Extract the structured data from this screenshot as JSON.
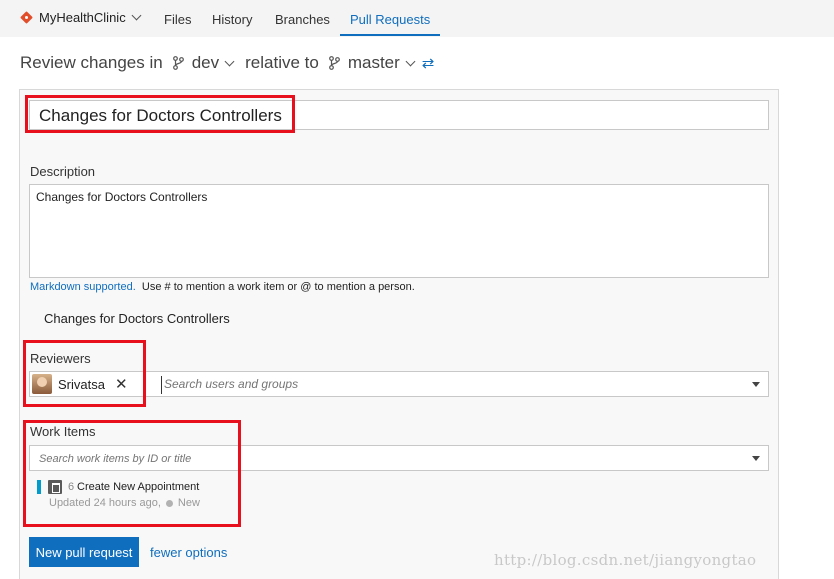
{
  "nav": {
    "repo_name": "MyHealthClinic",
    "tabs": [
      {
        "label": "Files"
      },
      {
        "label": "History"
      },
      {
        "label": "Branches"
      },
      {
        "label": "Pull Requests"
      }
    ],
    "active_tab": "Pull Requests"
  },
  "review": {
    "prefix": "Review changes in",
    "source_branch": "dev",
    "relative_text": "relative to",
    "target_branch": "master"
  },
  "form": {
    "title_value": "Changes for Doctors Controllers",
    "description_label": "Description",
    "description_value": "Changes for Doctors Controllers",
    "markdown_link": "Markdown supported.",
    "markdown_hint": "Use # to mention a work item or @ to mention a person.",
    "preview_text": "Changes for Doctors Controllers",
    "reviewers_label": "Reviewers",
    "reviewer_name": "Srivatsa",
    "reviewer_search_placeholder": "Search users and groups",
    "work_items_label": "Work Items",
    "work_items_search_placeholder": "Search work items by ID or title",
    "work_item": {
      "id": "6",
      "title": "Create New Appointment",
      "updated": "Updated 24 hours ago,",
      "state": "New"
    },
    "submit_label": "New pull request",
    "fewer_options_label": "fewer options"
  },
  "colors": {
    "accent": "#106ebe",
    "highlight": "#e8101c",
    "work_item_bar": "#009ccc",
    "git_icon": "#e24d2a"
  },
  "watermark": "http://blog.csdn.net/jiangyongtao"
}
